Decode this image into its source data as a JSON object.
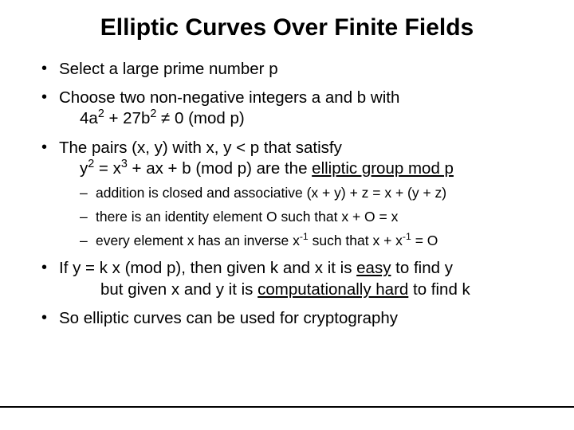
{
  "title": "Elliptic Curves Over Finite Fields",
  "bullets": {
    "b1": "Select a large prime number p",
    "b2": "Choose two non-negative integers a and b with",
    "b2_line2_pre": "4a",
    "b2_line2_sup1": "2",
    "b2_line2_mid": " + 27b",
    "b2_line2_sup2": "2",
    "b2_line2_post": "  ≠  0 (mod p)",
    "b3_pre": "The pairs (x, y) with x, y < p that satisfy",
    "b3_line2_a": "y",
    "b3_line2_sup1": "2",
    "b3_line2_b": " = x",
    "b3_line2_sup2": "3",
    "b3_line2_c": " + ax + b (mod p) are the ",
    "b3_line2_u": "elliptic group mod p",
    "sub1": "addition is closed and associative (x + y) + z = x + (y + z)",
    "sub2": "there is an identity element O such that x + O = x",
    "sub3_a": "every element x has an inverse x",
    "sub3_sup1": "-1",
    "sub3_b": " such that x + x",
    "sub3_sup2": "-1",
    "sub3_c": " = O",
    "b4_a": "If y = k x (mod p), then given k and x it is ",
    "b4_u1": "easy",
    "b4_b": " to find y",
    "b4_line2_a": "but given x and y it is ",
    "b4_line2_u": "computationally hard",
    "b4_line2_b": " to find k",
    "b5": "So elliptic curves can be used for cryptography"
  }
}
